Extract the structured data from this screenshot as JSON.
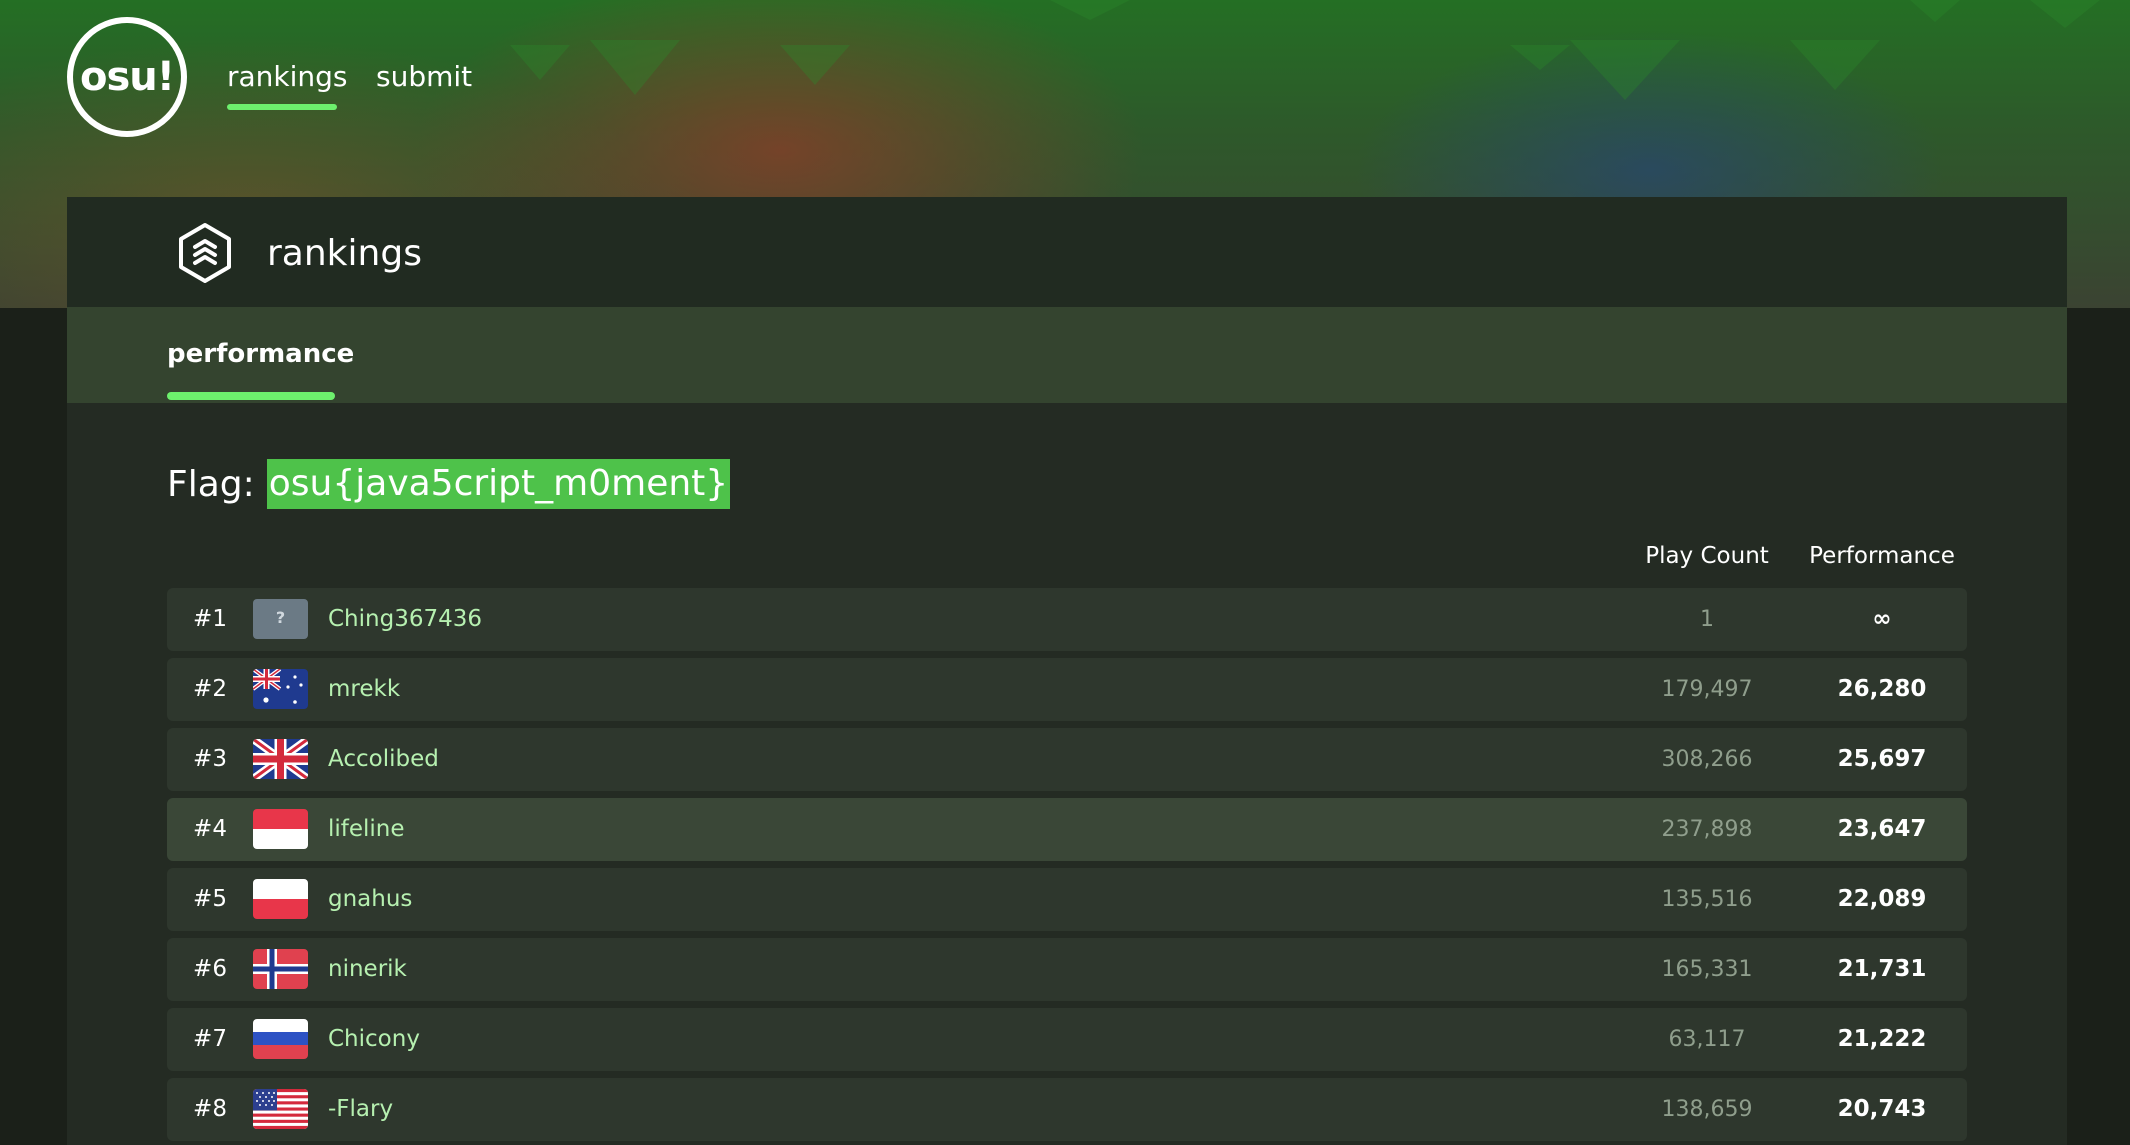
{
  "nav": {
    "logo_text": "osu!",
    "links": [
      {
        "label": "rankings",
        "active": true
      },
      {
        "label": "submit",
        "active": false
      }
    ]
  },
  "page_header": {
    "title": "rankings",
    "icon": "rankings-hexagon-icon"
  },
  "tabs": [
    {
      "label": "performance",
      "active": true
    }
  ],
  "flag": {
    "label": "Flag:",
    "value": "osu{java5cript_m0ment}"
  },
  "table": {
    "columns": [
      "Play Count",
      "Performance"
    ],
    "rows": [
      {
        "rank": "#1",
        "country": "unknown",
        "username": "Ching367436",
        "play_count": "1",
        "performance": "∞"
      },
      {
        "rank": "#2",
        "country": "australia",
        "username": "mrekk",
        "play_count": "179,497",
        "performance": "26,280"
      },
      {
        "rank": "#3",
        "country": "united-kingdom",
        "username": "Accolibed",
        "play_count": "308,266",
        "performance": "25,697"
      },
      {
        "rank": "#4",
        "country": "indonesia",
        "username": "lifeline",
        "play_count": "237,898",
        "performance": "23,647"
      },
      {
        "rank": "#5",
        "country": "poland",
        "username": "gnahus",
        "play_count": "135,516",
        "performance": "22,089"
      },
      {
        "rank": "#6",
        "country": "norway",
        "username": "ninerik",
        "play_count": "165,331",
        "performance": "21,731"
      },
      {
        "rank": "#7",
        "country": "russia",
        "username": "Chicony",
        "play_count": "63,117",
        "performance": "21,222"
      },
      {
        "rank": "#8",
        "country": "united-states",
        "username": "-Flary",
        "play_count": "138,659",
        "performance": "20,743"
      }
    ]
  },
  "colors": {
    "accent": "#6df06d",
    "flag_highlight": "#4ec24a",
    "username": "#b6f0b0"
  }
}
